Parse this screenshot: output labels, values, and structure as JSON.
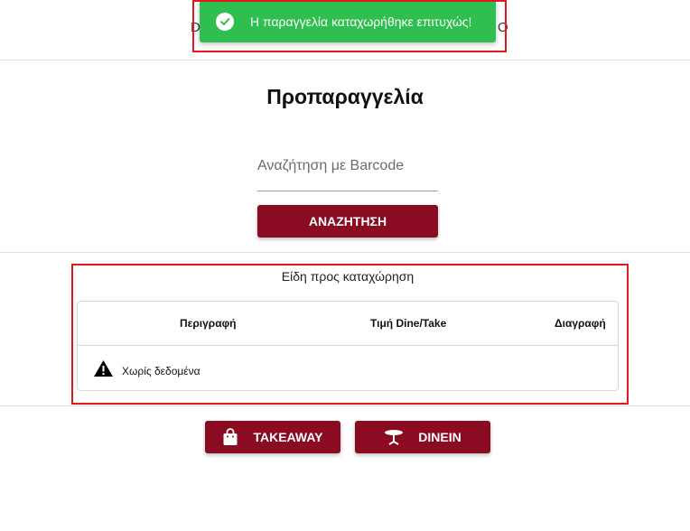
{
  "header": {
    "peek_left": "D",
    "peek_right": "O"
  },
  "toast": {
    "message": "Η παραγγελία καταχωρήθηκε επιτυχώς!",
    "icon": "check-circle-icon",
    "color": "#2ebf4e"
  },
  "page": {
    "title": "Προπαραγγελία"
  },
  "search": {
    "placeholder": "Αναζήτηση με Barcode",
    "value": "",
    "button_label": "ΑΝΑΖΗΤΗΣΗ"
  },
  "items": {
    "section_title": "Είδη προς καταχώρηση",
    "columns": [
      "Περιγραφή",
      "Τιμή Dine/Take",
      "Διαγραφή"
    ],
    "rows": [],
    "empty_message": "Χωρίς δεδομένα",
    "empty_icon": "warning-icon"
  },
  "actions": {
    "takeaway_label": "TAKEAWAY",
    "takeaway_icon": "shopping-bag-icon",
    "dinein_label": "DINEIN",
    "dinein_icon": "table-icon"
  },
  "colors": {
    "primary": "#8a0b22",
    "highlight": "#e3161b"
  }
}
